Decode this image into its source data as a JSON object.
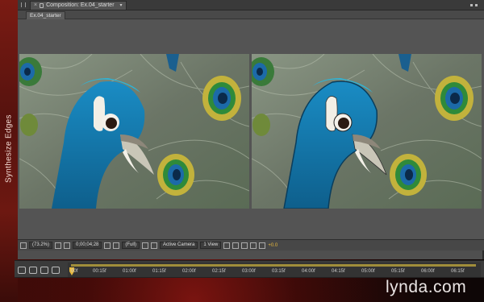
{
  "side_panel": {
    "label": "Synthesize Edges"
  },
  "composition_panel": {
    "tab_label": "Composition: Ex.04_starter",
    "close_glyph": "×",
    "menu_glyph": "▾",
    "subtab_label": "Ex.04_starter"
  },
  "viewer_toolbar": {
    "magnification": "(73.2%)",
    "timecode": "0;00;04;28",
    "resolution": "(Full)",
    "camera": "Active Camera",
    "views": "1 View",
    "exposure": "+0.0"
  },
  "timeline": {
    "ticks": [
      "00f",
      "00:15f",
      "01:00f",
      "01:15f",
      "02:00f",
      "02:15f",
      "03:00f",
      "03:15f",
      "04:00f",
      "04:15f",
      "05:00f",
      "05:15f",
      "06:00f",
      "06:15f"
    ]
  },
  "watermark": {
    "text": "lynda.com"
  },
  "colors": {
    "panel_bg": "#4f4f4f",
    "accent_exposure": "#e8b83c",
    "work_area": "#a08d3a",
    "peacock_blue": "#1b7fb0"
  },
  "icons": [
    "panel-grip-icon",
    "lock-icon",
    "close-icon",
    "menu-icon",
    "grid-icon",
    "snapshot-icon",
    "channel-icon",
    "camera-icon",
    "view-layout-icon",
    "toggle-icon",
    "fast-preview-icon",
    "exposure-icon"
  ]
}
